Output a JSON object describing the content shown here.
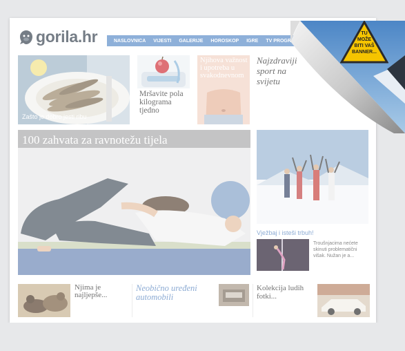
{
  "site": {
    "logo_text": "gorila.hr"
  },
  "nav": {
    "items": [
      "NASLOVNICA",
      "VIJESTI",
      "GALERIJE",
      "HOROSKOP",
      "IGRE",
      "TV PROGRAM"
    ]
  },
  "cards": {
    "fish_caption": "Zašto je dobro jesti ribu",
    "diet_title": "Mršavite pola kilograma tjedno",
    "body_text": "Njihova važnost i upotreba u svakodnevnom",
    "sport_title": "Najzdraviji sport na svijetu"
  },
  "hero": {
    "title": "100 zahvata za ravnotežu tijela"
  },
  "side": {
    "teaser_title": "Vježbaj i isteši trbuh!",
    "teaser_text": "Troušnjacima nećete skinuti problematični višak. Nužan je a..."
  },
  "bottom": {
    "item1": "Njima je najljepše...",
    "item2": "Neobično uređeni automobili",
    "item3": "Kolekcija ludih fotki..."
  },
  "banner": {
    "sign_text": [
      "TU",
      "MOŽE",
      "BITI VAŠ",
      "BANNER..."
    ]
  },
  "colors": {
    "nav": "#5e8fc9",
    "accent_blue": "#5b87c1",
    "sign_yellow": "#f5c400"
  }
}
